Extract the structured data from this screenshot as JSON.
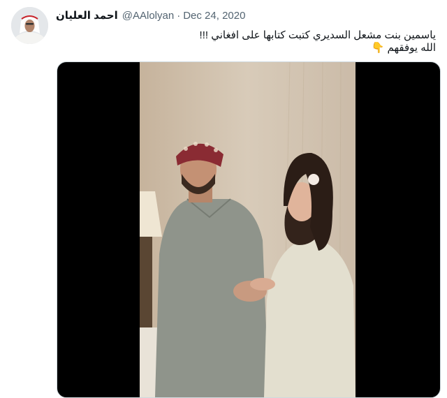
{
  "tweet": {
    "author_name": "احمد العليان",
    "handle": "@AAlolyan",
    "separator": "·",
    "date": "Dec 24, 2020",
    "text_line1": "ياسمين بنت مشعل السديري كتبت كتابها على افغاني !!!",
    "text_line2": "الله يوفقهم",
    "emoji": "👇"
  }
}
